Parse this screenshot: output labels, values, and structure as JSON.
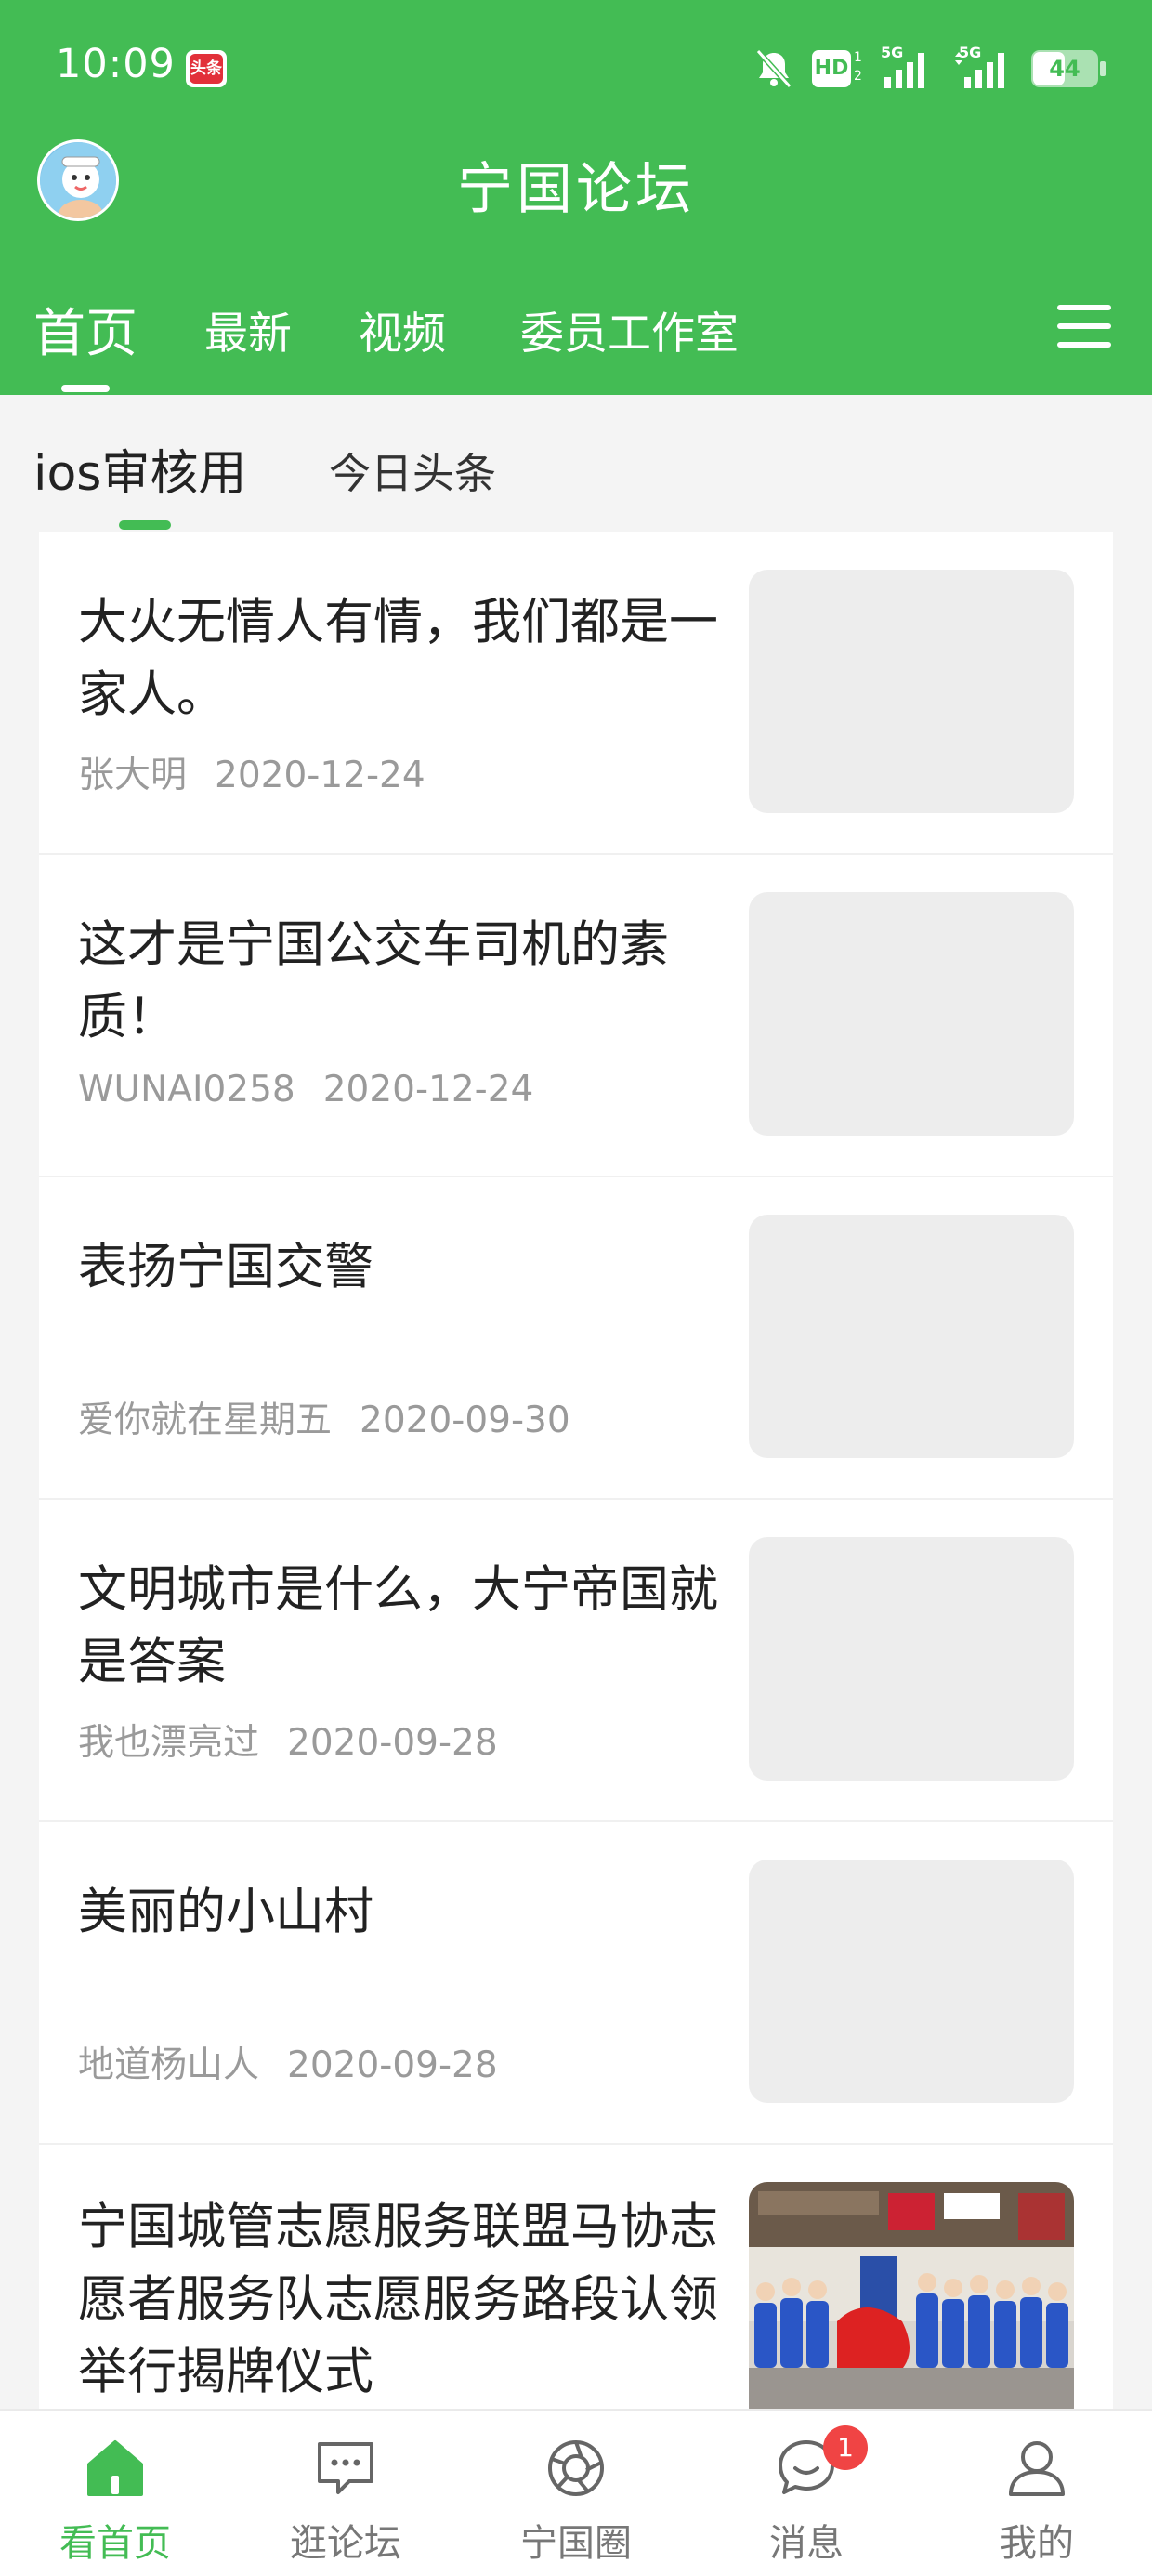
{
  "status_bar": {
    "time": "10:09",
    "app_badge": "头条",
    "battery": "44",
    "network": [
      "5G",
      "5G"
    ],
    "hd": "HD"
  },
  "header": {
    "title": "宁国论坛",
    "tabs": [
      "首页",
      "最新",
      "视频",
      "委员工作室"
    ],
    "active_tab": "首页"
  },
  "subtabs": [
    "ios审核用",
    "今日头条"
  ],
  "articles": [
    {
      "title": "大火无情人有情，我们都是一家人。",
      "author": "张大明",
      "date": "2020-12-24"
    },
    {
      "title": "这才是宁国公交车司机的素质！",
      "author": "WUNAI0258",
      "date": "2020-12-24"
    },
    {
      "title": "表扬宁国交警",
      "author": "爱你就在星期五",
      "date": "2020-09-30"
    },
    {
      "title": "文明城市是什么，大宁帝国就是答案",
      "author": "我也漂亮过",
      "date": "2020-09-28"
    },
    {
      "title": "美丽的小山村",
      "author": "地道杨山人",
      "date": "2020-09-28"
    },
    {
      "title": "宁国城管志愿服务联盟马协志愿者服务队志愿服务路段认领举行揭牌仪式",
      "author": "",
      "date": ""
    }
  ],
  "bottom_nav": [
    {
      "label": "看首页",
      "icon": "home-icon"
    },
    {
      "label": "逛论坛",
      "icon": "chat-box-icon"
    },
    {
      "label": "宁国圈",
      "icon": "camera-shutter-icon"
    },
    {
      "label": "消息",
      "icon": "message-icon",
      "badge": "1"
    },
    {
      "label": "我的",
      "icon": "user-icon"
    }
  ],
  "colors": {
    "brand_green": "#43bc54",
    "badge_red": "#f04444"
  }
}
